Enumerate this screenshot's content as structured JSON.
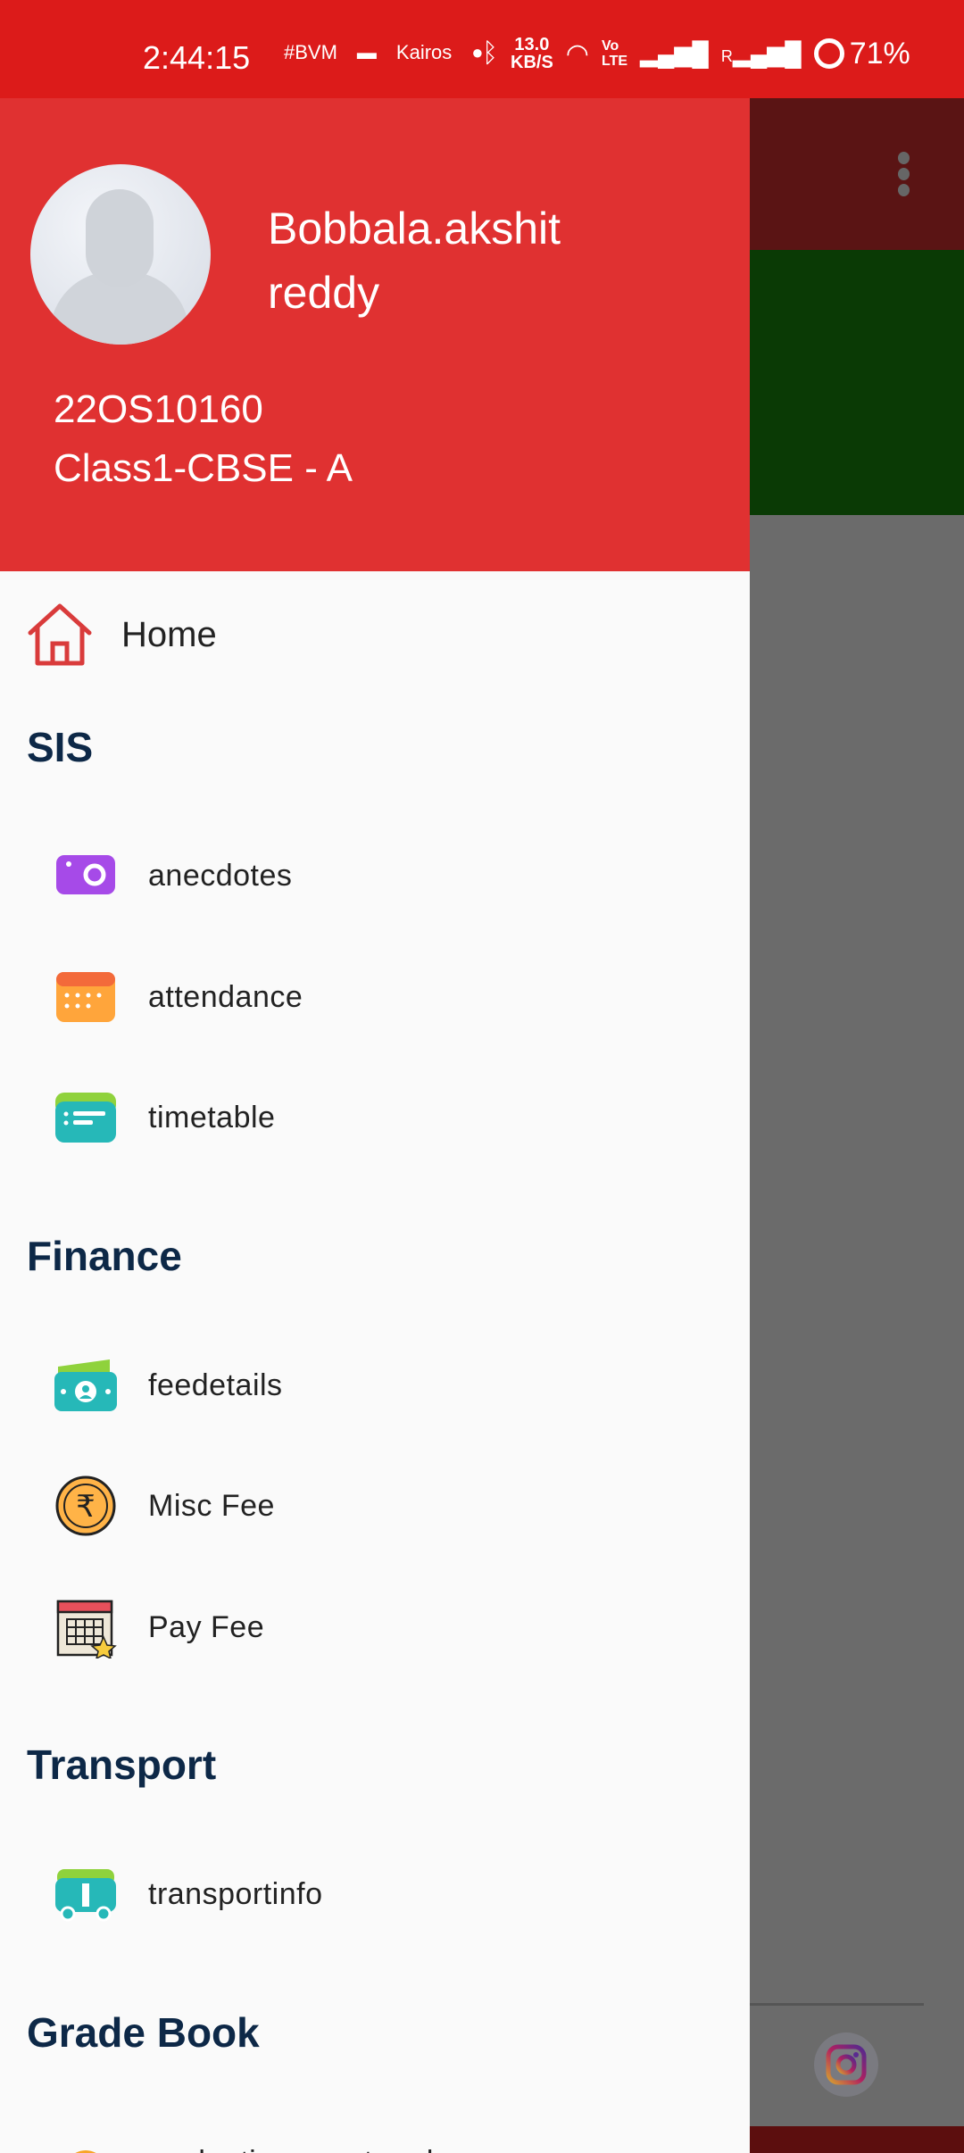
{
  "status_bar": {
    "time": "2:44:15",
    "notification_icons": [
      "bvm-logo",
      "countryside-logo",
      "kairos-logo",
      "dot"
    ],
    "network_speed": "13.0",
    "network_unit": "KB/S",
    "battery": "71%",
    "signal_label": "R"
  },
  "user": {
    "name": "Bobbala.akshit reddy",
    "id": "22OS10160",
    "class": "Class1-CBSE - A"
  },
  "home": {
    "label": "Home",
    "icon": "home-icon"
  },
  "sections": [
    {
      "title": "SIS",
      "items": [
        {
          "label": "anecdotes",
          "icon": "camera-icon"
        },
        {
          "label": "attendance",
          "icon": "calendar-icon"
        },
        {
          "label": "timetable",
          "icon": "timetable-icon"
        }
      ]
    },
    {
      "title": "Finance",
      "items": [
        {
          "label": "feedetails",
          "icon": "wallet-icon"
        },
        {
          "label": "Misc Fee",
          "icon": "rupee-coin-icon"
        },
        {
          "label": "Pay Fee",
          "icon": "calendar-star-icon"
        }
      ]
    },
    {
      "title": "Transport",
      "items": [
        {
          "label": "transportinfo",
          "icon": "bus-icon"
        }
      ]
    },
    {
      "title": "Grade Book",
      "items": [
        {
          "label": "evaluationreportcard",
          "icon": "rainbow-icon"
        }
      ]
    }
  ],
  "colors": {
    "status_bar": "#dc1b1a",
    "header": "#e03131",
    "section_title": "#0d2847",
    "toolbar": "#5a1414",
    "banner": "#0a3a05"
  }
}
